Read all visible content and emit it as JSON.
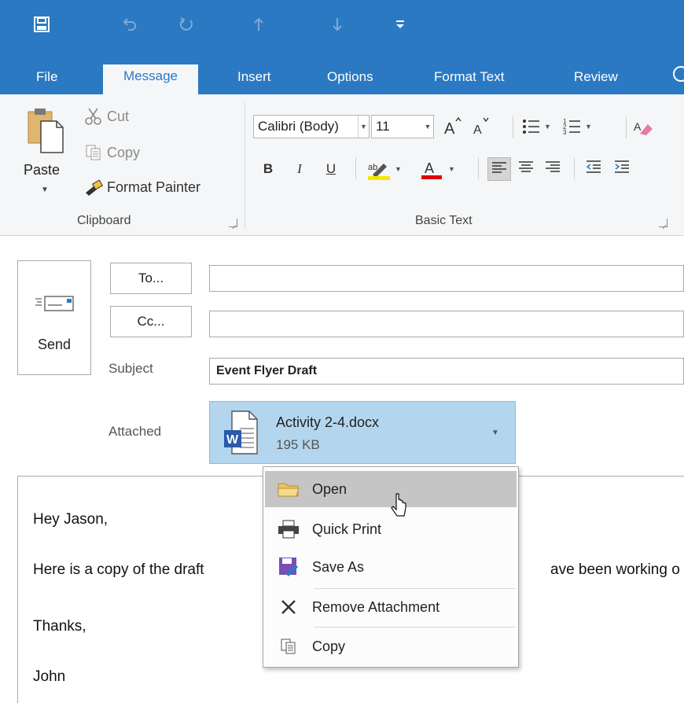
{
  "quick_access": {
    "icons": [
      "save-icon",
      "undo-icon",
      "redo-icon",
      "previous-item-icon",
      "next-item-icon",
      "customize-toolbar-icon"
    ]
  },
  "tabs": [
    {
      "label": "File"
    },
    {
      "label": "Message"
    },
    {
      "label": "Insert"
    },
    {
      "label": "Options"
    },
    {
      "label": "Format Text"
    },
    {
      "label": "Review"
    }
  ],
  "ribbon": {
    "clipboard": {
      "paste": "Paste",
      "cut": "Cut",
      "copy": "Copy",
      "format_painter": "Format Painter",
      "group_label": "Clipboard"
    },
    "basic_text": {
      "font_name": "Calibri (Body)",
      "font_size": "11",
      "bold": "B",
      "italic": "I",
      "underline": "U",
      "group_label": "Basic Text"
    }
  },
  "compose": {
    "send": "Send",
    "to_button": "To...",
    "cc_button": "Cc...",
    "to_value": "",
    "cc_value": "",
    "subject_label": "Subject",
    "subject_value": "Event Flyer Draft",
    "attached_label": "Attached",
    "attachment": {
      "name": "Activity 2-4.docx",
      "size": "195 KB"
    }
  },
  "body": {
    "lines": [
      "Hey Jason,",
      "Here is a copy of the draft",
      "ave been working o",
      "Thanks,",
      "John"
    ]
  },
  "context_menu": {
    "items": [
      {
        "label": "Open",
        "icon": "folder-icon",
        "hover": true
      },
      {
        "label": "Quick Print",
        "icon": "printer-icon"
      },
      {
        "label": "Save As",
        "icon": "save-as-icon"
      },
      {
        "label": "Remove Attachment",
        "icon": "remove-icon"
      },
      {
        "label": "Copy",
        "icon": "copy-icon"
      }
    ]
  },
  "colors": {
    "title_bar": "#2b79c2",
    "ribbon_bg": "#f5f6f7",
    "attachment_bg": "#b3d6ee",
    "menu_hover": "#c5c5c5",
    "highlight_yellow": "#f5e700",
    "font_color_red": "#e00000"
  }
}
